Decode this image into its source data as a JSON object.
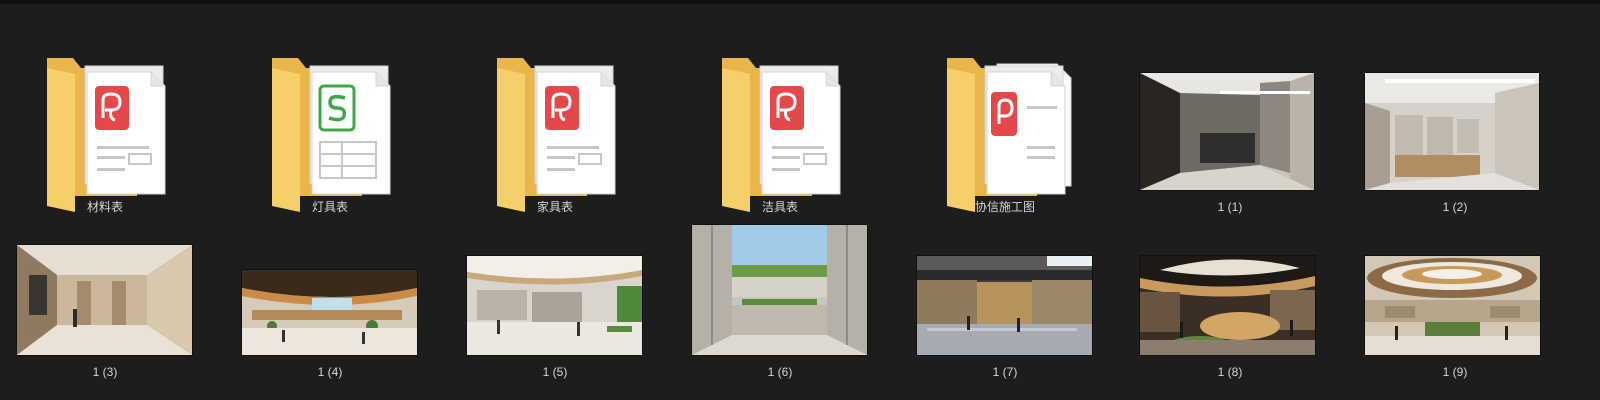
{
  "folders": [
    {
      "label": "材料表",
      "doc": "pdf-doc-icon"
    },
    {
      "label": "灯具表",
      "doc": "spreadsheet-doc-icon"
    },
    {
      "label": "家具表",
      "doc": "pdf-doc-icon"
    },
    {
      "label": "洁具表",
      "doc": "pdf-doc-icon"
    },
    {
      "label": "协信施工图",
      "doc": "pdf-doc-icon"
    }
  ],
  "images": [
    {
      "label": "1 (1)"
    },
    {
      "label": "1 (2)"
    },
    {
      "label": "1 (3)"
    },
    {
      "label": "1 (4)"
    },
    {
      "label": "1 (5)"
    },
    {
      "label": "1 (6)"
    },
    {
      "label": "1 (7)"
    },
    {
      "label": "1 (8)"
    },
    {
      "label": "1 (9)"
    }
  ],
  "colors": {
    "background": "#1d1d1d",
    "label_text": "#d6d6d6",
    "folder_yellow": "#f5cf6a",
    "pdf_red": "#e5484b",
    "sheet_green": "#3aa845"
  }
}
